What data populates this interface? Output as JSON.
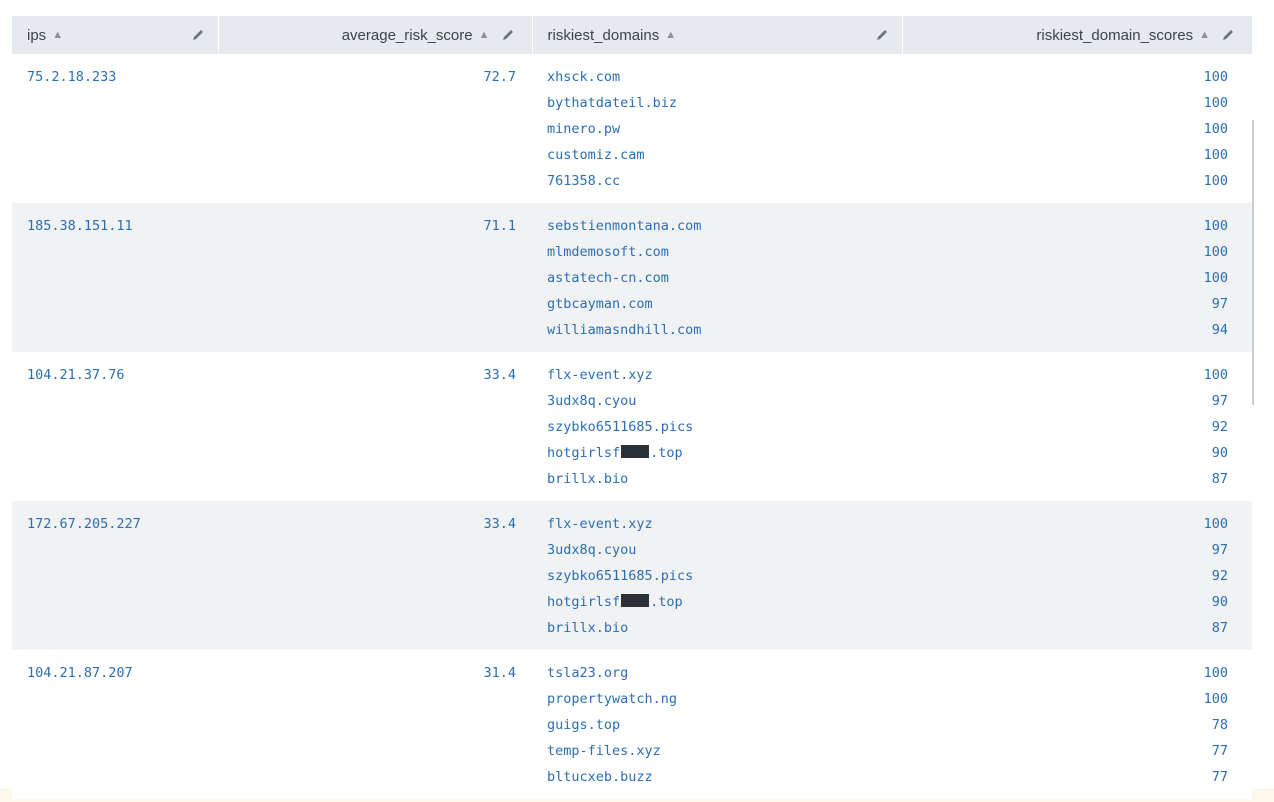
{
  "columns": [
    {
      "label": "ips",
      "align": "left"
    },
    {
      "label": "average_risk_score",
      "align": "right"
    },
    {
      "label": "riskiest_domains",
      "align": "left"
    },
    {
      "label": "riskiest_domain_scores",
      "align": "right"
    }
  ],
  "rows": [
    {
      "ip": "75.2.18.233",
      "avg": "72.7",
      "domains": [
        {
          "text": "xhsck.com"
        },
        {
          "text": "bythatdateil.biz"
        },
        {
          "text": "minero.pw"
        },
        {
          "text": "customiz.cam"
        },
        {
          "text": "761358.cc"
        }
      ],
      "scores": [
        "100",
        "100",
        "100",
        "100",
        "100"
      ]
    },
    {
      "ip": "185.38.151.11",
      "avg": "71.1",
      "domains": [
        {
          "text": "sebstienmontana.com"
        },
        {
          "text": "mlmdemosoft.com"
        },
        {
          "text": "astatech-cn.com"
        },
        {
          "text": "gtbcayman.com"
        },
        {
          "text": "williamasndhill.com"
        }
      ],
      "scores": [
        "100",
        "100",
        "100",
        "97",
        "94"
      ]
    },
    {
      "ip": "104.21.37.76",
      "avg": "33.4",
      "domains": [
        {
          "text": "flx-event.xyz"
        },
        {
          "text": "3udx8q.cyou"
        },
        {
          "text": "szybko6511685.pics"
        },
        {
          "prefix": "hotgirlsf",
          "suffix": ".top",
          "redacted": true
        },
        {
          "text": "brillx.bio"
        }
      ],
      "scores": [
        "100",
        "97",
        "92",
        "90",
        "87"
      ]
    },
    {
      "ip": "172.67.205.227",
      "avg": "33.4",
      "domains": [
        {
          "text": "flx-event.xyz"
        },
        {
          "text": "3udx8q.cyou"
        },
        {
          "text": "szybko6511685.pics"
        },
        {
          "prefix": "hotgirlsf",
          "suffix": ".top",
          "redacted": true
        },
        {
          "text": "brillx.bio"
        }
      ],
      "scores": [
        "100",
        "97",
        "92",
        "90",
        "87"
      ]
    },
    {
      "ip": "104.21.87.207",
      "avg": "31.4",
      "domains": [
        {
          "text": "tsla23.org"
        },
        {
          "text": "propertywatch.ng"
        },
        {
          "text": "guigs.top"
        },
        {
          "text": "temp-files.xyz"
        },
        {
          "text": "bltucxeb.buzz"
        }
      ],
      "scores": [
        "100",
        "100",
        "78",
        "77",
        "77"
      ]
    }
  ],
  "icons": {
    "sort": "sort-icon",
    "edit": "pencil-icon"
  },
  "colors": {
    "header_bg": "#e6e9ee",
    "link": "#2b6fb3",
    "stripe": "#f1f2f4",
    "redaction": "#2c3038"
  }
}
